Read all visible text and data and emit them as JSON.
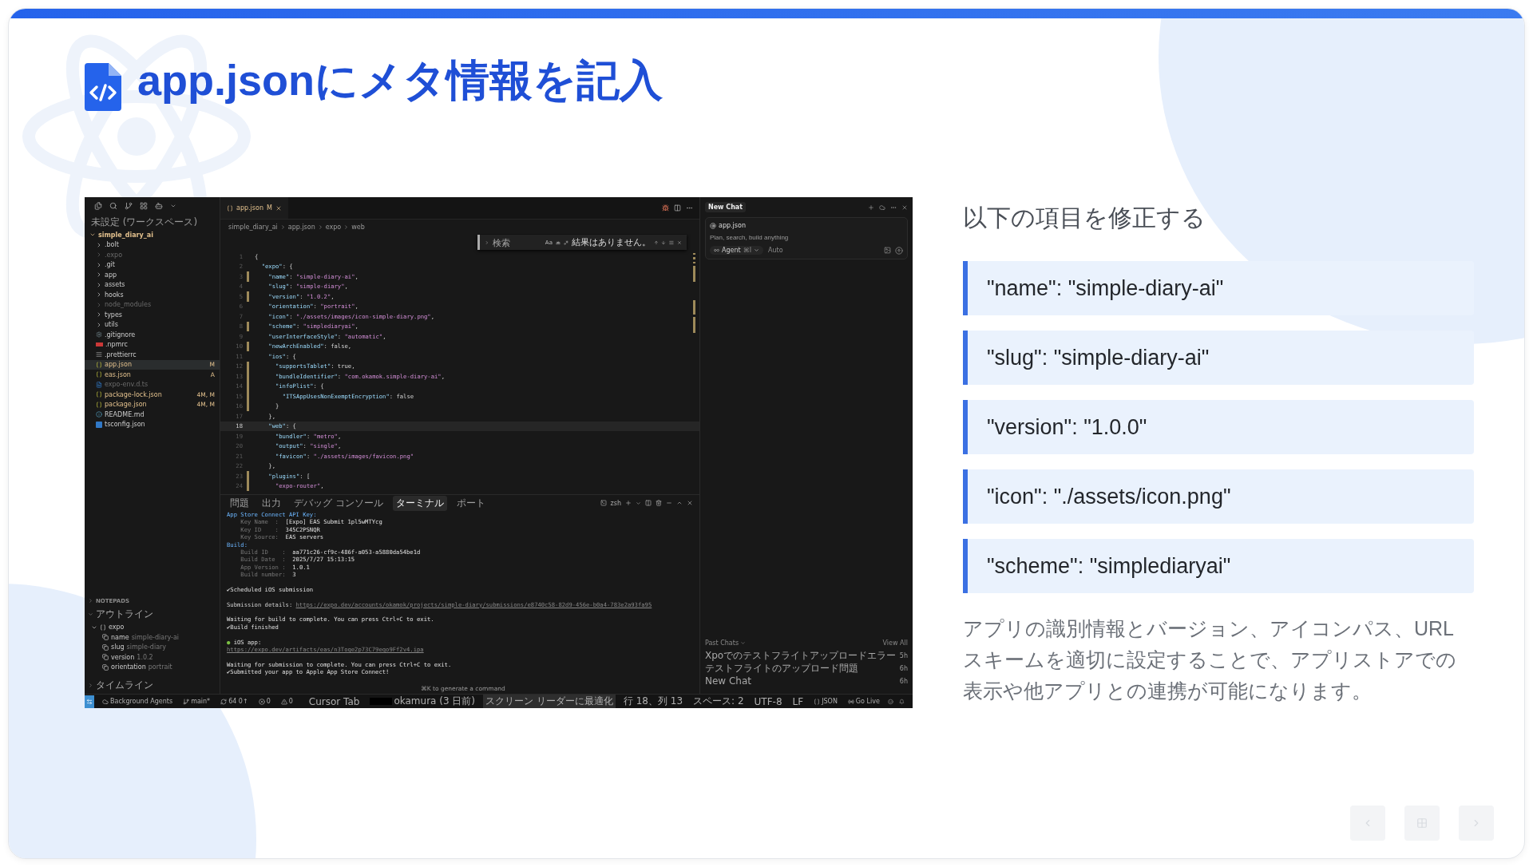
{
  "slide": {
    "title": "app.jsonにメタ情報を記入"
  },
  "screenshot": {
    "explorer": {
      "header": "未設定 (ワークスペース)",
      "root": {
        "label": "simple_diary_ai",
        "expanded": true,
        "children": [
          {
            "label": ".bolt",
            "kind": "folder",
            "expanded": false,
            "dimmed": false
          },
          {
            "label": ".expo",
            "kind": "folder",
            "expanded": false,
            "dimmed": true
          },
          {
            "label": ".git",
            "kind": "folder",
            "expanded": false,
            "dimmed": false
          },
          {
            "label": "app",
            "kind": "folder",
            "expanded": false,
            "dimmed": false
          },
          {
            "label": "assets",
            "kind": "folder",
            "expanded": false,
            "dimmed": false
          },
          {
            "label": "hooks",
            "kind": "folder",
            "expanded": false,
            "dimmed": false
          },
          {
            "label": "node_modules",
            "kind": "folder",
            "expanded": false,
            "dimmed": true
          },
          {
            "label": "types",
            "kind": "folder",
            "expanded": false,
            "dimmed": false
          },
          {
            "label": "utils",
            "kind": "folder",
            "expanded": false,
            "dimmed": false
          },
          {
            "label": ".gitignore",
            "kind": "gitignore",
            "dimmed": false
          },
          {
            "label": ".npmrc",
            "kind": "npmrc",
            "dimmed": false
          },
          {
            "label": ".prettierrc",
            "kind": "prettier",
            "dimmed": false
          },
          {
            "label": "app.json",
            "kind": "json",
            "dimmed": false,
            "badge": "M",
            "selected": true
          },
          {
            "label": "eas.json",
            "kind": "json",
            "dimmed": false,
            "badge": "A",
            "selected": false
          },
          {
            "label": "expo-env.d.ts",
            "kind": "ts",
            "dimmed": true
          },
          {
            "label": "package-lock.json",
            "kind": "json",
            "dimmed": false,
            "badge": "4M, M",
            "selected": false
          },
          {
            "label": "package.json",
            "kind": "json",
            "dimmed": false,
            "badge": "4M, M",
            "selected": false
          },
          {
            "label": "README.md",
            "kind": "readme",
            "dimmed": false
          },
          {
            "label": "tsconfig.json",
            "kind": "tsconfig",
            "dimmed": false
          }
        ]
      }
    },
    "notepads": "NOTEPADS",
    "outline": {
      "header": "アウトライン",
      "root": {
        "label": "expo",
        "expanded": true,
        "children": [
          {
            "key": "name",
            "value": "simple-diary-ai"
          },
          {
            "key": "slug",
            "value": "simple-diary"
          },
          {
            "key": "version",
            "value": "1.0.2"
          },
          {
            "key": "orientation",
            "value": "portrait"
          }
        ]
      }
    },
    "timeline": "タイムライン",
    "editor": {
      "tab": {
        "label": "app.json",
        "badge": "M"
      },
      "breadcrumb": [
        "simple_diary_ai",
        "app.json",
        "expo",
        "web"
      ],
      "find": {
        "placeholder": "検索",
        "case_label": "Aa",
        "result": "結果はありません。"
      },
      "lines": [
        {
          "number": "1",
          "text": "{",
          "changed": false,
          "current": false
        },
        {
          "number": "2",
          "text": "  \"expo\": {",
          "changed": false,
          "current": false
        },
        {
          "number": "3",
          "text": "    \"name\": \"simple-diary-ai\",",
          "changed": true,
          "current": false
        },
        {
          "number": "4",
          "text": "    \"slug\": \"simple-diary\",",
          "changed": false,
          "current": false
        },
        {
          "number": "5",
          "text": "    \"version\": \"1.0.2\",",
          "changed": true,
          "current": false
        },
        {
          "number": "6",
          "text": "    \"orientation\": \"portrait\",",
          "changed": false,
          "current": false
        },
        {
          "number": "7",
          "text": "    \"icon\": \"./assets/images/icon-simple-diary.png\",",
          "changed": false,
          "current": false
        },
        {
          "number": "8",
          "text": "    \"scheme\": \"simplediaryai\",",
          "changed": true,
          "current": false
        },
        {
          "number": "9",
          "text": "    \"userInterfaceStyle\": \"automatic\",",
          "changed": false,
          "current": false
        },
        {
          "number": "10",
          "text": "    \"newArchEnabled\": false,",
          "changed": true,
          "current": false
        },
        {
          "number": "11",
          "text": "    \"ios\": {",
          "changed": false,
          "current": false
        },
        {
          "number": "12",
          "text": "      \"supportsTablet\": true,",
          "changed": true,
          "current": false
        },
        {
          "number": "13",
          "text": "      \"bundleIdentifier\": \"com.okamok.simple-diary-ai\",",
          "changed": true,
          "current": false
        },
        {
          "number": "14",
          "text": "      \"infoPlist\": {",
          "changed": true,
          "current": false
        },
        {
          "number": "15",
          "text": "        \"ITSAppUsesNonExemptEncryption\": false",
          "changed": true,
          "current": false
        },
        {
          "number": "16",
          "text": "      }",
          "changed": true,
          "current": false
        },
        {
          "number": "17",
          "text": "    },",
          "changed": false,
          "current": false
        },
        {
          "number": "18",
          "text": "    \"web\": {",
          "changed": false,
          "current": true
        },
        {
          "number": "19",
          "text": "      \"bundler\": \"metro\",",
          "changed": false,
          "current": false
        },
        {
          "number": "20",
          "text": "      \"output\": \"single\",",
          "changed": false,
          "current": false
        },
        {
          "number": "21",
          "text": "      \"favicon\": \"./assets/images/favicon.png\"",
          "changed": false,
          "current": false
        },
        {
          "number": "22",
          "text": "    },",
          "changed": false,
          "current": false
        },
        {
          "number": "23",
          "text": "    \"plugins\": [",
          "changed": true,
          "current": false
        },
        {
          "number": "24",
          "text": "      \"expo-router\",",
          "changed": true,
          "current": false
        }
      ]
    },
    "panel": {
      "tabs": [
        {
          "label": "問題",
          "selected": false
        },
        {
          "label": "出力",
          "selected": false
        },
        {
          "label": "デバッグ コンソール",
          "selected": false
        },
        {
          "label": "ターミナル",
          "selected": true
        },
        {
          "label": "ポート",
          "selected": false
        }
      ],
      "shell": "zsh",
      "terminal": [
        {
          "kind": "heading",
          "text": "App Store Connect API Key:"
        },
        {
          "kind": "field",
          "key": "    Key Name  :",
          "value": "[Expo] EAS Submit 1pl5wMTYcg"
        },
        {
          "kind": "field",
          "key": "    Key ID    :",
          "value": "345C2PSNQR"
        },
        {
          "kind": "field",
          "key": "    Key Source:",
          "value": "EAS servers"
        },
        {
          "kind": "heading",
          "text": "Build:"
        },
        {
          "kind": "field",
          "key": "    Build ID    :",
          "value": "aa771c26-cf9c-486f-a053-a5880da54be1d"
        },
        {
          "kind": "field",
          "key": "    Build Date  :",
          "value": "2025/7/27 15:13:15"
        },
        {
          "kind": "field",
          "key": "    App Version :",
          "value": "1.0.1"
        },
        {
          "kind": "field",
          "key": "    Build number:",
          "value": "3"
        },
        {
          "kind": "gap"
        },
        {
          "kind": "text",
          "text": "✔Scheduled iOS submission"
        },
        {
          "kind": "gap"
        },
        {
          "kind": "link-field",
          "key": "Submission details:",
          "value": "https://expo.dev/accounts/okamok/projects/simple-diary/submissions/e8740c58-82d9-456e-b0a4-783e2a93fa95"
        },
        {
          "kind": "gap"
        },
        {
          "kind": "text",
          "text": "Waiting for build to complete. You can press Ctrl+C to exit."
        },
        {
          "kind": "text",
          "text": "✔Build finished"
        },
        {
          "kind": "gap"
        },
        {
          "kind": "app",
          "bullet": "●",
          "text": "iOS app:"
        },
        {
          "kind": "link",
          "text": "https://expo.dev/artifacts/eas/n3Toqe2p73C79eqo9Ff2v4.ipa"
        },
        {
          "kind": "gap"
        },
        {
          "kind": "text",
          "text": "Waiting for submission to complete. You can press Ctrl+C to exit."
        },
        {
          "kind": "text",
          "text": "✔Submitted your app to Apple App Store Connect!"
        }
      ],
      "hint": "⌘K to generate a command"
    },
    "chat": {
      "tab": "New Chat",
      "context": "app.json",
      "placeholder": "Plan, search, build anything",
      "mode": "Agent",
      "mode_shortcut": "⌘I",
      "model": "Auto",
      "past_header": "Past Chats",
      "view_all": "View All",
      "past": [
        {
          "title": "Xpoでのテストフライトアップロードエラー",
          "age": "5h"
        },
        {
          "title": "テストフライトのアップロード問題",
          "age": "6h"
        },
        {
          "title": "New Chat",
          "age": "6h"
        }
      ]
    },
    "status_bar": {
      "left": [
        {
          "kind": "agents",
          "text": "Background Agents"
        },
        {
          "kind": "branch",
          "text": "main*"
        },
        {
          "kind": "sync",
          "text": "64 0↑"
        },
        {
          "kind": "errors",
          "text": "0"
        },
        {
          "kind": "warnings",
          "text": "0"
        }
      ],
      "right": [
        {
          "kind": "plain",
          "text": "Cursor Tab"
        },
        {
          "kind": "author",
          "text": "okamura (3 日前)"
        },
        {
          "kind": "highlight",
          "text": "スクリーン リーダーに最適化"
        },
        {
          "kind": "plain",
          "text": "行 18、列 13"
        },
        {
          "kind": "plain",
          "text": "スペース: 2"
        },
        {
          "kind": "plain",
          "text": "UTF-8"
        },
        {
          "kind": "plain",
          "text": "LF"
        },
        {
          "kind": "language",
          "text": "JSON"
        },
        {
          "kind": "live",
          "text": "Go Live"
        }
      ]
    }
  },
  "aside": {
    "heading": "以下の項目を修正する",
    "items": [
      "\"name\": \"simple-diary-ai\"",
      "\"slug\": \"simple-diary-ai\"",
      "\"version\": \"1.0.0\"",
      "\"icon\": \"./assets/icon.png\"",
      "\"scheme\": \"simplediaryai\""
    ],
    "note": "アプリの識別情報とバージョン、アイコンパス、URLスキームを適切に設定することで、アプリストアでの表示や他アプリとの連携が可能になります。"
  }
}
